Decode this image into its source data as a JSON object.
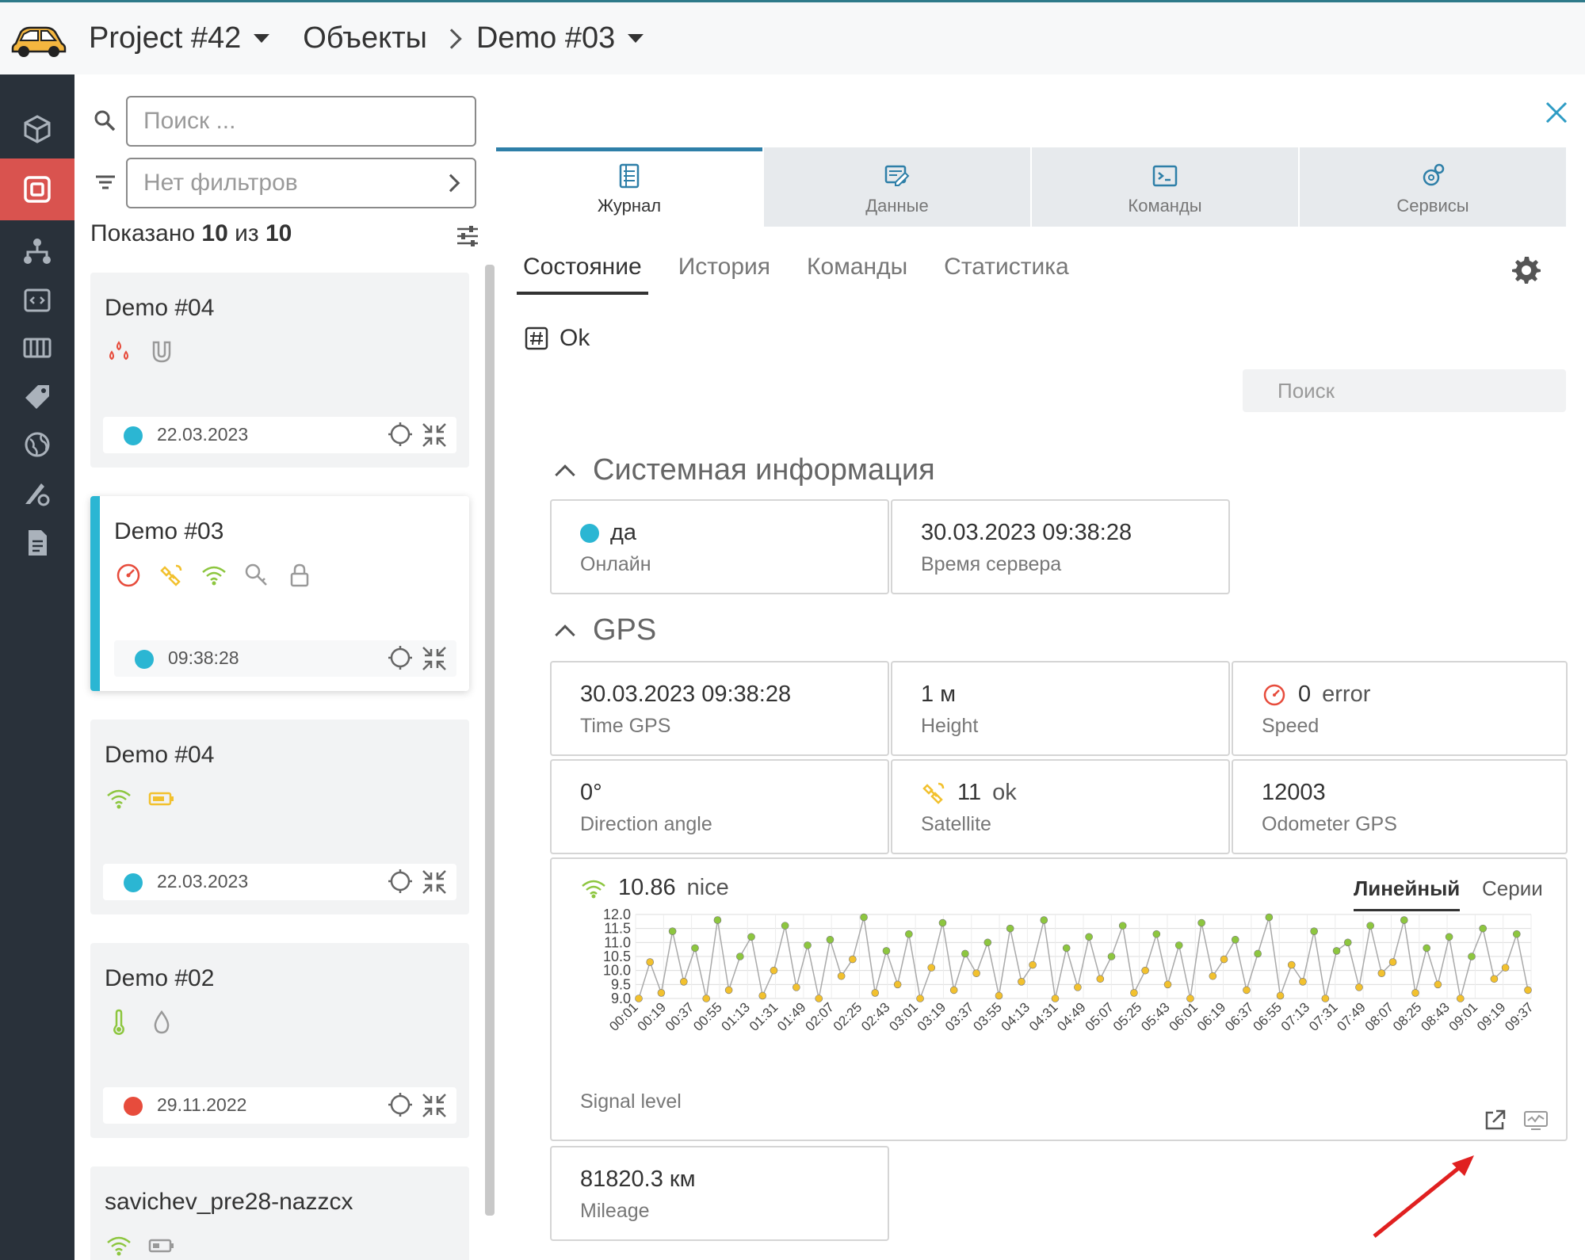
{
  "topbar": {
    "project": "Project #42",
    "section": "Объекты",
    "object": "Demo #03"
  },
  "list": {
    "search_placeholder": "Поиск ...",
    "filter_placeholder": "Нет фильтров",
    "shown_prefix": "Показано",
    "shown_count": "10",
    "shown_of": "из",
    "shown_total": "10",
    "cards": [
      {
        "title": "Demo #04",
        "date": "22.03.2023",
        "status_color": "#2bb6d3"
      },
      {
        "title": "Demo #03",
        "date": "09:38:28",
        "status_color": "#2bb6d3"
      },
      {
        "title": "Demo #04",
        "date": "22.03.2023",
        "status_color": "#2bb6d3"
      },
      {
        "title": "Demo #02",
        "date": "29.11.2022",
        "status_color": "#e74c3c"
      },
      {
        "title": "savichev_pre28-nazzcx"
      }
    ]
  },
  "tabs": [
    {
      "label": "Журнал",
      "icon": "journal-icon"
    },
    {
      "label": "Данные",
      "icon": "data-icon"
    },
    {
      "label": "Команды",
      "icon": "terminal-icon"
    },
    {
      "label": "Сервисы",
      "icon": "services-icon"
    }
  ],
  "subtabs": [
    "Состояние",
    "История",
    "Команды",
    "Статистика"
  ],
  "status_text": "Ok",
  "search_placeholder": "Поиск",
  "sections": {
    "system": {
      "title": "Системная информация",
      "online": {
        "value": "да",
        "label": "Онлайн"
      },
      "server_time": {
        "value": "30.03.2023 09:38:28",
        "label": "Время сервера"
      }
    },
    "gps": {
      "title": "GPS",
      "time_gps": {
        "value": "30.03.2023 09:38:28",
        "label": "Time GPS"
      },
      "height": {
        "value": "1 м",
        "label": "Height"
      },
      "speed": {
        "value": "0",
        "status": "error",
        "label": "Speed"
      },
      "direction": {
        "value": "0°",
        "label": "Direction angle"
      },
      "satellite": {
        "value": "11",
        "status": "ok",
        "label": "Satellite"
      },
      "odometer": {
        "value": "12003",
        "label": "Odometer GPS"
      },
      "signal": {
        "value": "10.86",
        "status": "nice",
        "label": "Signal level",
        "view_line": "Линейный",
        "view_series": "Серии"
      },
      "mileage": {
        "value": "81820.3 км",
        "label": "Mileage"
      }
    }
  },
  "colors": {
    "accent": "#2e7fa8",
    "online": "#2bb6d3",
    "error": "#e74c3c",
    "rail": "#29313a",
    "rail_active": "#d9534f",
    "point_high": "#8dc63f",
    "point_low": "#f2c12e"
  },
  "chart_data": {
    "type": "line",
    "ylim": [
      9.0,
      12.0
    ],
    "yticks": [
      "12.0",
      "11.5",
      "11.0",
      "10.5",
      "10.0",
      "9.5",
      "9.0"
    ],
    "xticks": [
      "00:01",
      "00:19",
      "00:37",
      "00:55",
      "01:13",
      "01:31",
      "01:49",
      "02:07",
      "02:25",
      "02:43",
      "03:01",
      "03:19",
      "03:37",
      "03:55",
      "04:13",
      "04:31",
      "04:49",
      "05:07",
      "05:25",
      "05:43",
      "06:01",
      "06:19",
      "06:37",
      "06:55",
      "07:13",
      "07:31",
      "07:49",
      "08:07",
      "08:25",
      "08:43",
      "09:01",
      "09:19",
      "09:37"
    ],
    "ylabel": "Signal level",
    "series": [
      {
        "values": [
          9.0,
          10.3,
          9.2,
          11.4,
          9.6,
          10.8,
          9.0,
          11.8,
          9.3,
          10.5,
          11.2,
          9.1,
          10.0,
          11.6,
          9.4,
          10.9,
          9.0,
          11.1,
          9.8,
          10.4,
          11.9,
          9.2,
          10.7,
          9.5,
          11.3,
          9.0,
          10.1,
          11.7,
          9.3,
          10.6,
          9.9,
          11.0,
          9.1,
          11.5,
          9.6,
          10.2,
          11.8,
          9.0,
          10.8,
          9.4,
          11.2,
          9.7,
          10.5,
          11.6,
          9.2,
          10.0,
          11.3,
          9.5,
          10.9,
          9.0,
          11.7,
          9.8,
          10.4,
          11.1,
          9.3,
          10.6,
          11.9,
          9.1,
          10.2,
          9.6,
          11.4,
          9.0,
          10.7,
          11.0,
          9.4,
          11.6,
          9.9,
          10.3,
          11.8,
          9.2,
          10.8,
          9.5,
          11.2,
          9.0,
          10.5,
          11.5,
          9.7,
          10.1,
          11.3,
          9.3
        ],
        "color_high": "#8dc63f",
        "color_low": "#f2c12e"
      }
    ]
  }
}
